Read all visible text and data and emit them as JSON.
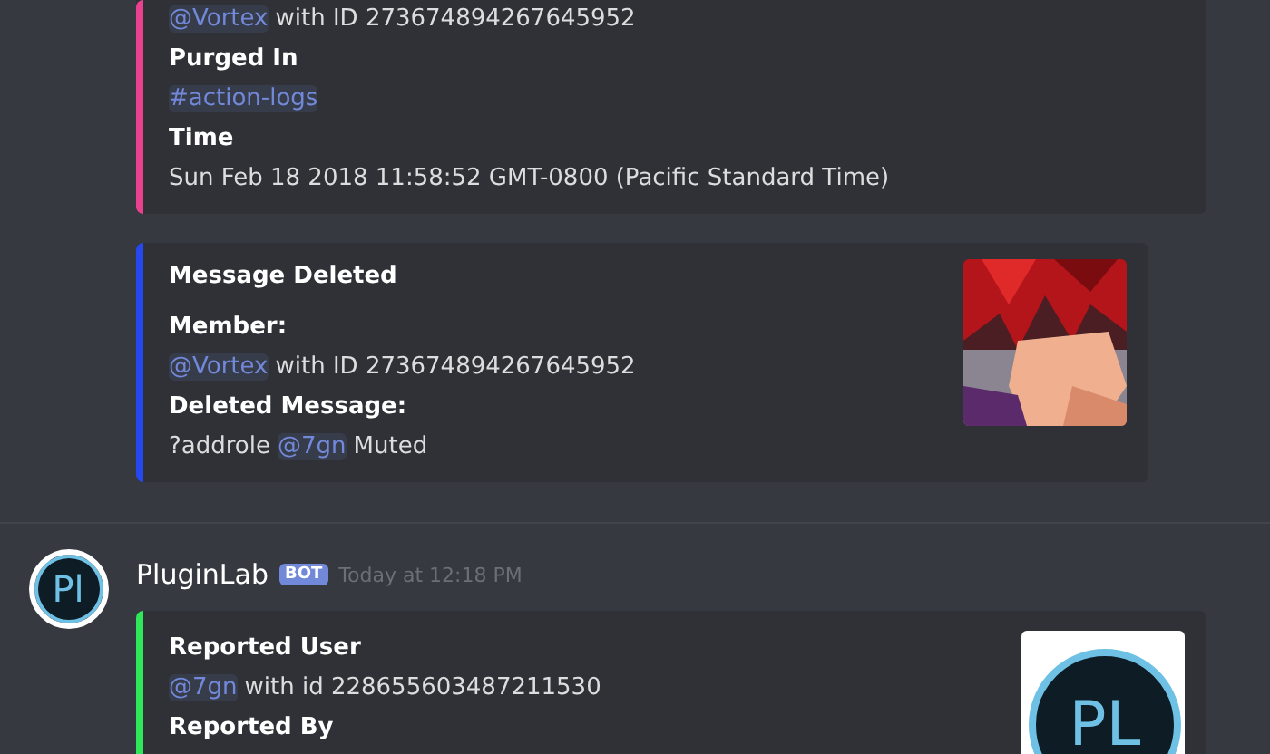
{
  "messages": [
    {
      "embeds": [
        {
          "color": "#e9418f",
          "lines": [
            {
              "kind": "value",
              "parts": [
                {
                  "kind": "mention",
                  "text": "@Vortex"
                },
                {
                  "kind": "plain",
                  "text": "with ID 273674894267645952"
                }
              ]
            },
            {
              "kind": "name",
              "text": "Purged In"
            },
            {
              "kind": "value",
              "parts": [
                {
                  "kind": "mention",
                  "text": "#action-logs"
                }
              ]
            },
            {
              "kind": "name",
              "text": "Time"
            },
            {
              "kind": "value",
              "parts": [
                {
                  "kind": "plain",
                  "text": "Sun Feb 18 2018 11:58:52 GMT-0800 (Pacific Standard Time)"
                }
              ]
            }
          ]
        },
        {
          "color": "#2548f0",
          "title": "Message Deleted",
          "thumbnail": {
            "kind": "picture"
          },
          "lines": [
            {
              "kind": "name",
              "text": "Member:"
            },
            {
              "kind": "value",
              "parts": [
                {
                  "kind": "mention",
                  "text": "@Vortex"
                },
                {
                  "kind": "plain",
                  "text": "with ID 273674894267645952"
                }
              ]
            },
            {
              "kind": "name",
              "text": "Deleted Message:"
            },
            {
              "kind": "value",
              "parts": [
                {
                  "kind": "plain",
                  "text": "?addrole"
                },
                {
                  "kind": "mention",
                  "text": "@7gn"
                },
                {
                  "kind": "plain",
                  "text": "Muted"
                }
              ]
            }
          ]
        }
      ]
    },
    {
      "author": {
        "name": "PluginLab",
        "badge": "BOT",
        "timestamp": "Today at 12:18 PM",
        "avatar_text": "Pl"
      },
      "embeds": [
        {
          "color": "#2ee85a",
          "thumbnail": {
            "kind": "logo",
            "text": "PL"
          },
          "lines": [
            {
              "kind": "name",
              "text": "Reported User"
            },
            {
              "kind": "value",
              "parts": [
                {
                  "kind": "mention",
                  "text": "@7gn"
                },
                {
                  "kind": "plain",
                  "text": "with id 228655603487211530"
                }
              ]
            },
            {
              "kind": "name",
              "text": "Reported By"
            }
          ]
        }
      ]
    }
  ]
}
